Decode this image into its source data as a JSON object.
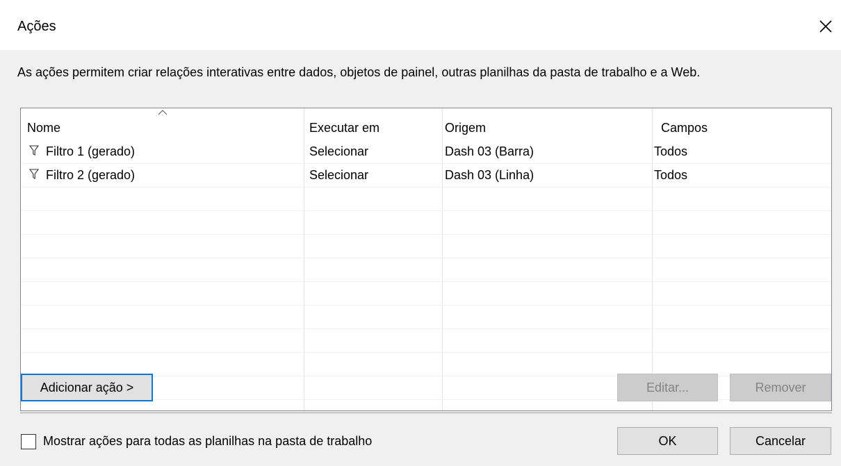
{
  "dialog": {
    "title": "Ações",
    "description": "As ações permitem criar relações interativas entre dados, objetos de painel, outras planilhas da pasta de trabalho e a Web."
  },
  "table": {
    "columns": [
      "Nome",
      "Executar em",
      "Origem",
      "Campos"
    ],
    "rows": [
      {
        "name": "Filtro 1 (gerado)",
        "run_on": "Selecionar",
        "source": "Dash 03 (Barra)",
        "fields": "Todos",
        "icon": "filter-icon"
      },
      {
        "name": "Filtro 2 (gerado)",
        "run_on": "Selecionar",
        "source": "Dash 03 (Linha)",
        "fields": "Todos",
        "icon": "filter-icon"
      }
    ]
  },
  "buttons": {
    "add": "Adicionar ação >",
    "edit": "Editar...",
    "remove": "Remover",
    "ok": "OK",
    "cancel": "Cancelar"
  },
  "footer": {
    "show_all_label": "Mostrar ações para todas as planilhas na pasta de trabalho",
    "show_all_checked": false
  },
  "colors": {
    "accent": "#0078d7",
    "dialog_bg": "#f0f0f0",
    "disabled_bg": "#cccccc"
  }
}
